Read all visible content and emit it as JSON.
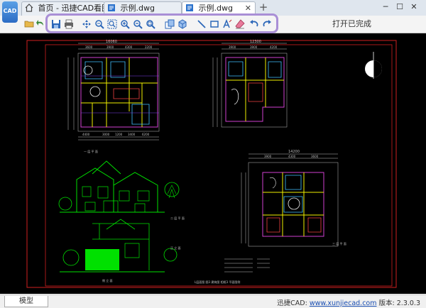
{
  "app": {
    "logo_text": "CAD"
  },
  "tabs": [
    {
      "label": "首页 - 迅捷CAD看图"
    },
    {
      "label": "示例.dwg"
    },
    {
      "label": "示例.dwg"
    }
  ],
  "toolbar": {
    "status": "打开已完成"
  },
  "drawing": {
    "label_a": "一 层 平 面",
    "label_b": "二 层 平 面",
    "label_c": "正 立 面",
    "label_d": "侧 立 面",
    "label_e": "三 层 平 面",
    "label_bottom": "L层面图   图3 建筑图   相框3 平面图例",
    "dims_top": [
      "16060",
      "3600",
      "3900",
      "4300",
      "2200"
    ],
    "dims_bottom": [
      "4400",
      "3000",
      "1200",
      "3400",
      "6200"
    ],
    "dims_right_top": [
      "12300",
      "3900",
      "3900",
      "4200"
    ],
    "dims_right_plan": [
      "14200",
      "3900",
      "4300",
      "3600"
    ]
  },
  "bottom": {
    "model_tab": "模型",
    "brand": "迅捷CAD:",
    "url": "www.xunjiecad.com",
    "version": "版本: 2.3.0.3"
  }
}
